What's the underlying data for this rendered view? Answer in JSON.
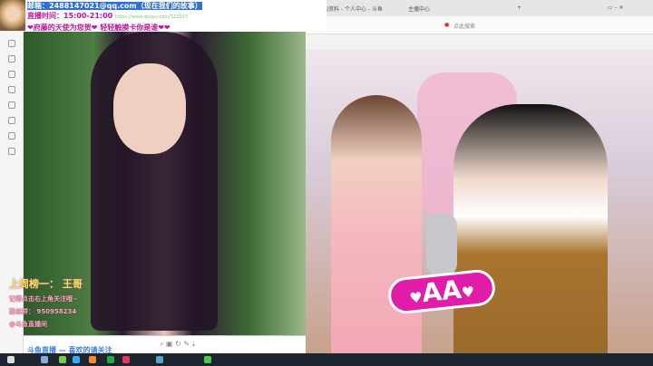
{
  "browser": {
    "tabs": [
      "我的资料 - 个人中心 - 斗鱼",
      "主播中心"
    ],
    "new_tab": "+",
    "search_label": "点此搜索"
  },
  "info": {
    "email": "邮箱：2488147021@qq.com（现在我们的故事）",
    "schedule": "直播时间：15:00-21:00",
    "url": "https://www.douyu.com/322227",
    "slogan": "❤府藤的天使为您贺❤ 轻轻触摸卡你是谁❤❤"
  },
  "overlay": {
    "top_fan": "上周榜一： 王哥",
    "follow": "记得点击右上角关注哦~",
    "fan_group": "粉丝群：  950958234",
    "weibo": "@斗鱼直播间"
  },
  "stream": {
    "sign": "AA"
  },
  "bottom": {
    "banner": "斗鱼直播 — 喜欢的请关注"
  }
}
